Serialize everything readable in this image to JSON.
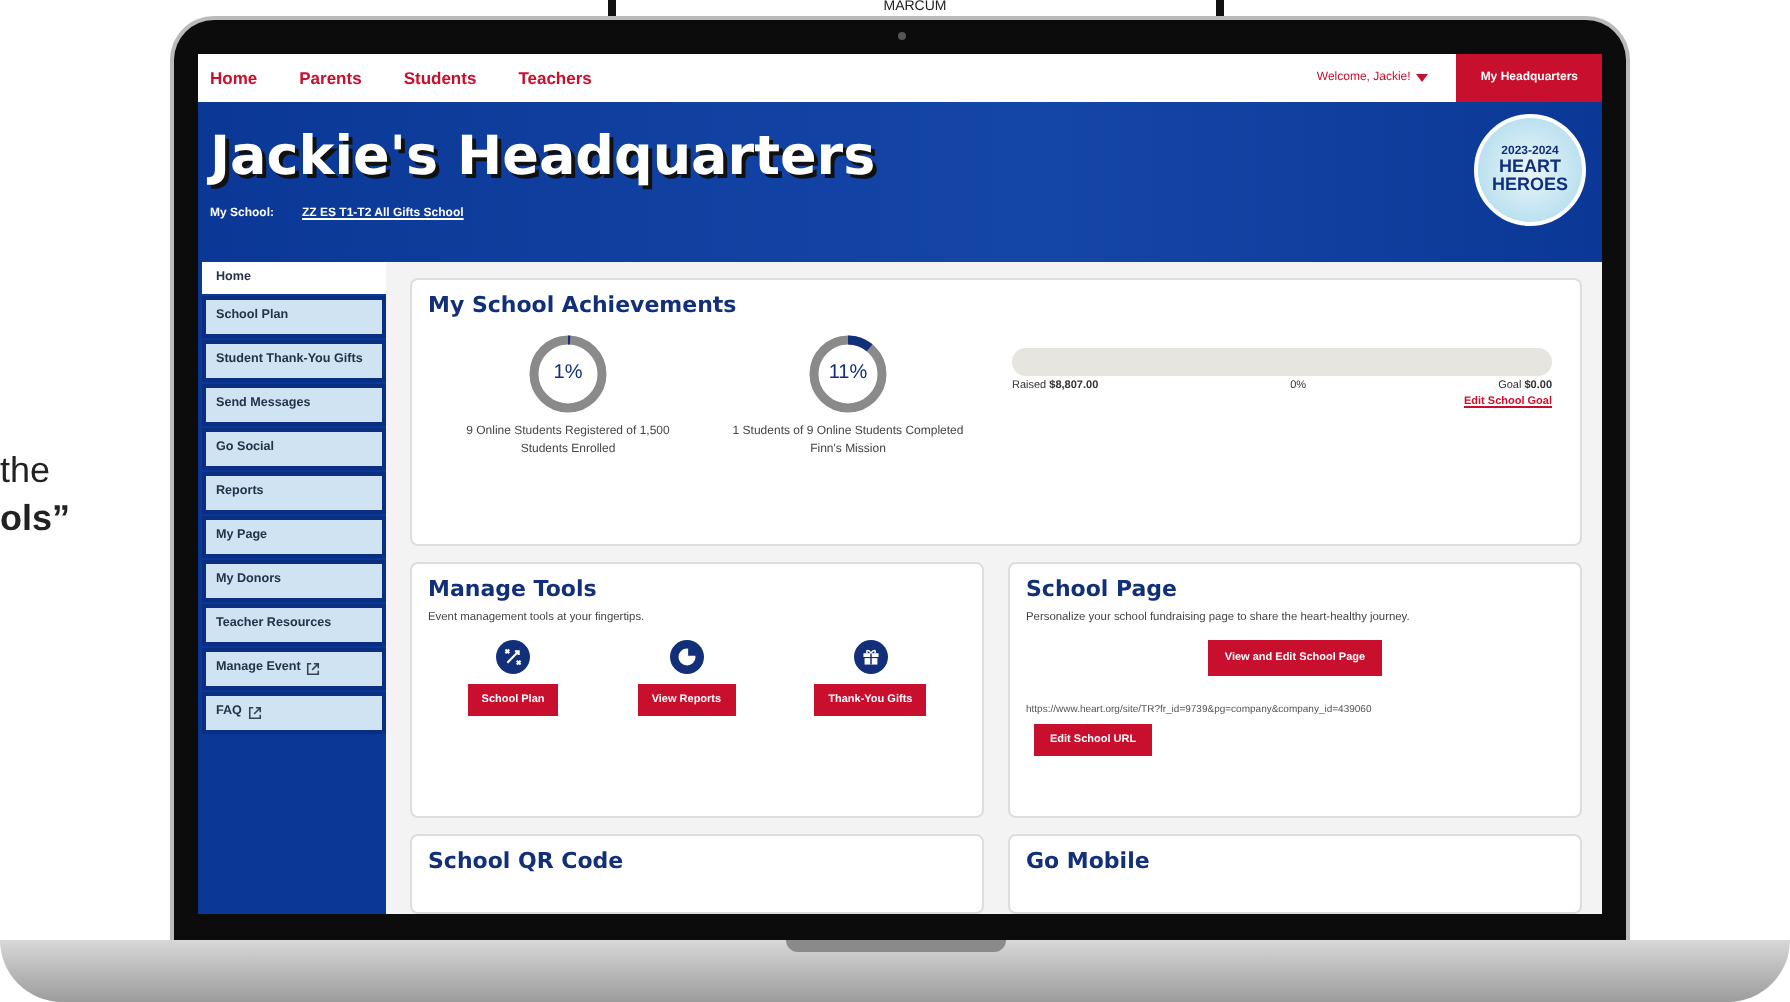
{
  "backdrop": {
    "sign_text": "MARCUM",
    "caption_fragments": [
      "the",
      "ols”"
    ]
  },
  "nav": {
    "links": [
      {
        "label": "Home"
      },
      {
        "label": "Parents"
      },
      {
        "label": "Students"
      },
      {
        "label": "Teachers"
      }
    ],
    "welcome": "Welcome, Jackie!",
    "hq_button": "My Headquarters"
  },
  "banner": {
    "title": "Jackie's Headquarters",
    "school_label": "My School:",
    "school_link": "ZZ ES T1-T2 All Gifts School",
    "badge_lines": [
      "2023-2024",
      "HEART",
      "HEROES"
    ]
  },
  "sidebar": {
    "items": [
      {
        "label": "Home",
        "selected": true,
        "external": false
      },
      {
        "label": "School Plan",
        "selected": false,
        "external": false
      },
      {
        "label": "Student Thank-You Gifts",
        "selected": false,
        "external": false
      },
      {
        "label": "Send Messages",
        "selected": false,
        "external": false
      },
      {
        "label": "Go Social",
        "selected": false,
        "external": false
      },
      {
        "label": "Reports",
        "selected": false,
        "external": false
      },
      {
        "label": "My Page",
        "selected": false,
        "external": false
      },
      {
        "label": "My Donors",
        "selected": false,
        "external": false
      },
      {
        "label": "Teacher Resources",
        "selected": false,
        "external": false
      },
      {
        "label": "Manage Event",
        "selected": false,
        "external": true
      },
      {
        "label": "FAQ",
        "selected": false,
        "external": true
      }
    ]
  },
  "achievements": {
    "title": "My School Achievements",
    "rings": [
      {
        "value": "1%",
        "level": 0.01,
        "caption": "9 Online Students Registered of 1,500 Students Enrolled"
      },
      {
        "value": "11%",
        "level": 0.11,
        "caption": "1 Students of 9 Online Students Completed Finn's Mission"
      }
    ],
    "goal": {
      "level": 0,
      "raised_label": "Raised",
      "raised": "$8,807.00",
      "percent": "0%",
      "goal_label": "Goal",
      "goal": "$0.00",
      "link": "Edit School Goal"
    }
  },
  "manage_tools": {
    "title": "Manage Tools",
    "subtitle": "Event management tools at your fingertips.",
    "tools": [
      {
        "kind": "plan",
        "label": "School Plan"
      },
      {
        "kind": "chart",
        "label": "View Reports"
      },
      {
        "kind": "gift",
        "label": "Thank-You Gifts"
      }
    ]
  },
  "school_page": {
    "title": "School Page",
    "text": "Personalize your school fundraising page to share the heart-healthy journey.",
    "button": "View and Edit School Page",
    "url": "https://www.heart.org/site/TR?fr_id=9739&pg=company&company_id=439060",
    "url_button": "Edit School URL"
  },
  "lower_cards": [
    {
      "title": "School QR Code"
    },
    {
      "title": "Go Mobile"
    }
  ]
}
